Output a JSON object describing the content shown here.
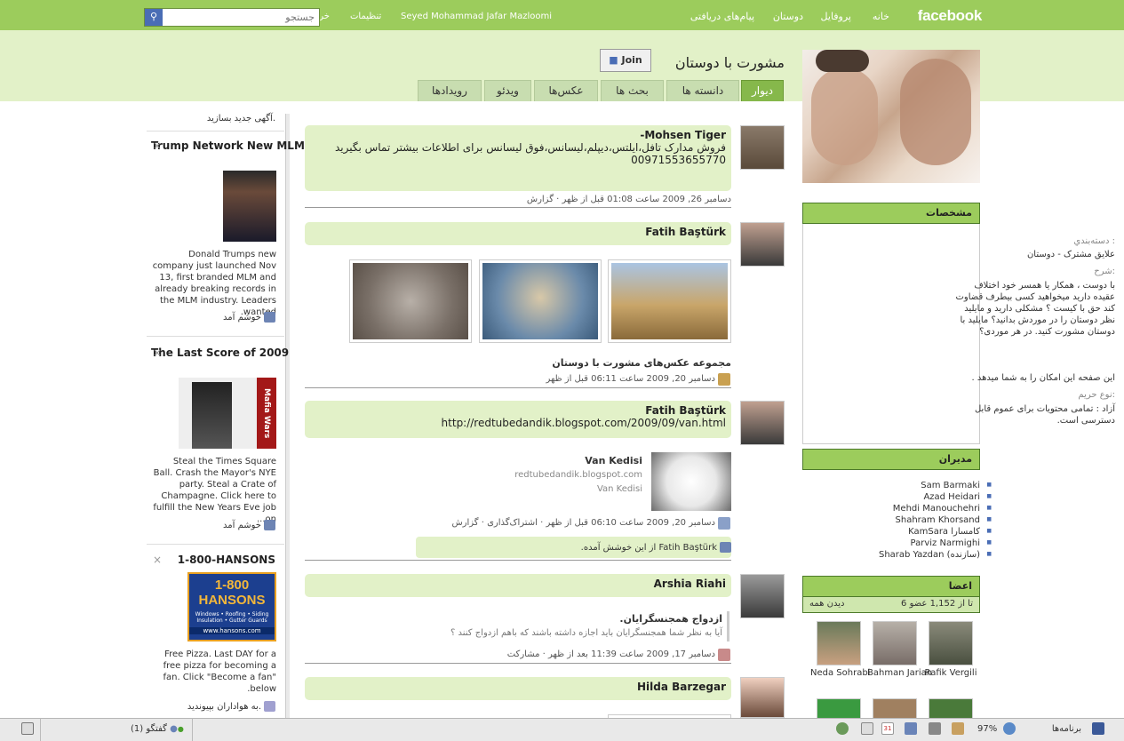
{
  "topnav": {
    "logo": "facebook",
    "home": "خانه",
    "profile": "پروفایل",
    "friends": "دوستان",
    "inbox": "پیام‌های دریافتی",
    "username": "Seyed Mohammad Jafar Mazloomi",
    "settings": "تنظیمات",
    "logout": "خروج",
    "search_placeholder": "جستجو"
  },
  "group": {
    "title": "مشورت با دوستان",
    "join_label": "Join",
    "tabs": [
      "دیوار",
      "دانسته ها",
      "بحث ها",
      "عکس‌ها",
      "ویدئو",
      "رویدادها"
    ]
  },
  "info": {
    "header": "مشخصات",
    "category_label": "دسته‌بندي :",
    "category_value": "علایق مشترک - دوستان",
    "desc_label": "شرح:",
    "desc_value": "با دوست ، همکار یا همسر خود اختلاف عقیده دارید میخواهید کسی بیطرف قضاوت کند حق با کیست ؟ مشکلی دارید و مایلید نظر دوستان را در موردش بدانید؟ مایلید با دوستان مشورت کنید. در هر موردی؟",
    "desc_value2": "این صفحه این امکان را به شما میدهد .",
    "privacy_label": "نوع حریم:",
    "privacy_value": "آزاد : تمامی محتویات برای عموم قابل دسترسی است."
  },
  "admins": {
    "header": "مدیران",
    "list": [
      "Sam Barmaki",
      "Azad Heidari",
      "Mehdi Manouchehri",
      "Shahram Khorsand",
      "KamSara کامسارا",
      "Parviz Narmighi",
      "Sharab Yazdan (سازنده)"
    ]
  },
  "members": {
    "header": "اعضا",
    "count": "6 تا از 1,152 عضو",
    "see_all": "دیدن همه",
    "names": [
      "Rafik Vergili",
      "Bahman Jarian",
      "Neda Sohrabi"
    ]
  },
  "ad_new": "آگهی جدید بسازید.",
  "ads": [
    {
      "title": "Trump Network New MLM",
      "text": "Donald Trumps new company just launched Nov 13, first branded MLM and already breaking records in the MLM industry. Leaders wanted.",
      "like": "خوشم آمد"
    },
    {
      "title": "The Last Score of 2009",
      "text": "Steal the Times Square Ball. Crash the Mayor's NYE party. Steal a Crate of Champagne. Click here to fulfill the New Years Eve job on...",
      "like": "خوشم آمد",
      "image_text": "Mafia Wars"
    },
    {
      "title": "1-800-HANSONS",
      "text": "Free Pizza. Last DAY for a free pizza for becoming a fan. Click \"Become a fan\" below.",
      "like": "به هواداران بپیوندید.",
      "image_text": "1-800 HANSONS",
      "image_sub": "Windows • Roofing • Siding Insulation • Gutter Guards",
      "image_url": "www.hansons.com"
    }
  ],
  "posts": [
    {
      "name": "Mohsen Tiger-",
      "body": "فروش مدارک تافل،ایلتس،دیپلم،لیسانس،فوق لیسانس برای اطلاعات بیشتر تماس بگیرید",
      "phone": "00971553655770",
      "meta": "دسامبر 26, 2009 ساعت 01:08 قبل از ظهر · گزارش"
    },
    {
      "name": "Fatih Baştürk",
      "album": "مجموعه عکس‌های مشورت با دوستان",
      "meta": "دسامبر 20, 2009 ساعت 06:11 قبل از ظهر"
    },
    {
      "name": "Fatih Baştürk",
      "link": "http://redtubedandik.blogspot.com/2009/09/van.html",
      "link_title": "Van Kedisi",
      "link_domain": "redtubedandik.blogspot.com",
      "link_desc": "Van Kedisi",
      "meta": "دسامبر 20, 2009 ساعت 06:10 قبل از ظهر · اشتراک‌گذاری · گزارش",
      "like_line": "Fatih Baştürk از این خوشش آمده."
    },
    {
      "name": "Arshia Riahi",
      "note_title": "ازدواج همجنسگرایان.",
      "note_text": "آیا به نظر شما همجنسگرایان باید اجازه داشته باشند که باهم ازدواج کنند ؟",
      "meta": "دسامبر 17, 2009 ساعت 11:39 بعد از ظهر · مشارکت"
    },
    {
      "name": "Hilda Barzegar"
    }
  ],
  "bottom": {
    "apps": "برنامه‌ها",
    "zoom": "97%",
    "date_icon": "31",
    "chat": "گفتگو (1)"
  }
}
